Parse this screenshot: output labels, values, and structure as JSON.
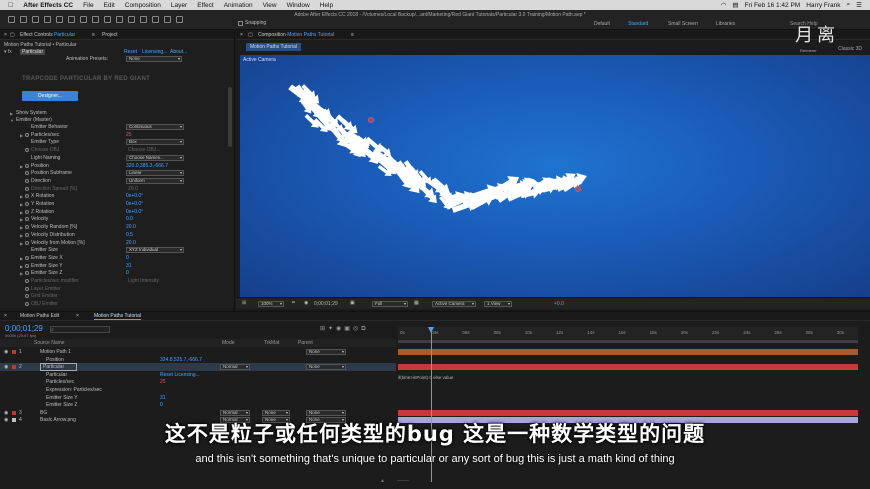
{
  "menubar": {
    "apple": "",
    "app": "After Effects CC",
    "items": [
      "File",
      "Edit",
      "Composition",
      "Layer",
      "Effect",
      "Animation",
      "View",
      "Window",
      "Help"
    ],
    "right": {
      "datetime": "Fri Feb 16  1:42 PM",
      "user": "Harry Frank"
    }
  },
  "window_title": "Adobe After Effects CC 2018 - /Volumes/Local Backup/...ant/Marketing/Red Giant Tutorials/Particular 3.0 Training/Motion Path.aep *",
  "toolbar": {
    "snapping": "Snapping"
  },
  "workspaces": {
    "default": "Default",
    "standard": "Standard",
    "small": "Small Screen",
    "libraries": "Libraries",
    "search": "Search Help",
    "classic": "Classic 3D"
  },
  "logo": {
    "glyph": "月离",
    "caption": "Renderer"
  },
  "effect_controls": {
    "tab": "Effect Controls",
    "tab_target": "Particular",
    "project_tab": "Project",
    "breadcrumb": "Motion Paths Tutorial • Particular",
    "fx_name": "Particular",
    "reset": "Reset",
    "licensing": "Licensing...",
    "about": "About...",
    "presets_label": "Animation Presets:",
    "presets_value": "None",
    "brand": "TRAPCODE PARTICULAR BY RED GIANT",
    "designer_btn": "Designer...",
    "show_system": "Show System",
    "emitter_group": "Emitter (Master)",
    "props": [
      {
        "name": "Emitter Behavior",
        "value": "Continuous",
        "kind": "select"
      },
      {
        "name": "Particles/sec",
        "value": "25",
        "kind": "red"
      },
      {
        "name": "Emitter Type",
        "value": "Box",
        "kind": "select"
      },
      {
        "name": "Choose OBJ",
        "value": "Choose OBJ...",
        "kind": "dim"
      },
      {
        "name": "Light Naming",
        "value": "Choose Names...",
        "kind": "button"
      },
      {
        "name": "Position",
        "value": "320.0,385.3,-666.7",
        "kind": "blue"
      },
      {
        "name": "Position Subframe",
        "value": "Linear",
        "kind": "select"
      },
      {
        "name": "Direction",
        "value": "Uniform",
        "kind": "select"
      },
      {
        "name": "Direction Spread [%]",
        "value": "20.0",
        "kind": "dim"
      },
      {
        "name": "X Rotation",
        "value": "0x+0.0°",
        "kind": "blue"
      },
      {
        "name": "Y Rotation",
        "value": "0x+0.0°",
        "kind": "blue"
      },
      {
        "name": "Z Rotation",
        "value": "0x+0.0°",
        "kind": "blue"
      },
      {
        "name": "Velocity",
        "value": "0.0",
        "kind": "blue"
      },
      {
        "name": "Velocity Random [%]",
        "value": "20.0",
        "kind": "blue"
      },
      {
        "name": "Velocity Distribution",
        "value": "0.5",
        "kind": "blue"
      },
      {
        "name": "Velocity from Motion [%]",
        "value": "20.0",
        "kind": "blue"
      },
      {
        "name": "Emitter Size",
        "value": "XYZ Individual",
        "kind": "select"
      },
      {
        "name": "Emitter Size X",
        "value": "0",
        "kind": "blue"
      },
      {
        "name": "Emitter Size Y",
        "value": "31",
        "kind": "blue"
      },
      {
        "name": "Emitter Size Z",
        "value": "0",
        "kind": "blue"
      },
      {
        "name": "Particles/sec modifier",
        "value": "Light Intensity",
        "kind": "dim"
      },
      {
        "name": "Layer Emitter",
        "value": "",
        "kind": "dim"
      },
      {
        "name": "Grid Emitter",
        "value": "",
        "kind": "dim"
      },
      {
        "name": "OBJ Emitter",
        "value": "",
        "kind": "dim"
      }
    ]
  },
  "composition": {
    "tab": "Composition",
    "tab_target": "Motion Paths Tutorial",
    "subtab": "Motion Paths Tutorial",
    "active_camera": "Active Camera",
    "viewer_bar": {
      "zoom": "100%",
      "time": "0;00;01;29",
      "resolution": "Full",
      "camera": "Active Camera",
      "view": "1 View",
      "exposure": "+0.0"
    }
  },
  "timeline": {
    "tabs": [
      "Motion Paths Edit",
      "Motion Paths Tutorial"
    ],
    "timecode": "0;00;01;29",
    "fps": "00059 (29.97 fps)",
    "columns": {
      "source": "Source Name",
      "mode": "Mode",
      "trkmat": "TrkMat",
      "parent": "Parent"
    },
    "ruler": [
      "0s",
      "04s",
      "06s",
      "08s",
      "10s",
      "12s",
      "14s",
      "16s",
      "18s",
      "20s",
      "22s",
      "24s",
      "26s",
      "28s",
      "30s"
    ],
    "layers": [
      {
        "num": "1",
        "name": "Motion Path 1",
        "color": "#c0392b",
        "parent": "None"
      },
      {
        "num": "",
        "name": "Position",
        "sub": true,
        "value": "324.8,525.7,-666.7"
      },
      {
        "num": "2",
        "name": "Particular",
        "color": "#c0392b",
        "mode": "Normal",
        "trk": "",
        "parent": "None",
        "selected": true
      },
      {
        "num": "",
        "name": "Particular",
        "sub": true,
        "value": "Reset   Licensing..."
      },
      {
        "num": "",
        "name": "Particles/sec",
        "sub": true,
        "value": "25"
      },
      {
        "num": "",
        "name": "Expression: Particles/sec",
        "sub": true,
        "value": ""
      },
      {
        "num": "",
        "name": "Emitter Size Y",
        "sub": true,
        "value": "31"
      },
      {
        "num": "",
        "name": "Emitter Size Z",
        "sub": true,
        "value": "0"
      },
      {
        "num": "3",
        "name": "BG",
        "color": "#c0392b",
        "mode": "Normal",
        "trk": "None",
        "parent": "None"
      },
      {
        "num": "4",
        "name": "Basic Arrow.png",
        "color": "#c0c0c0",
        "mode": "Normal",
        "trk": "None",
        "parent": "None"
      }
    ],
    "expression_text": "if(time>inPoint) 0 else value"
  },
  "subtitles": {
    "cn": "这不是粒子或任何类型的bug  这是一种数学类型的问题",
    "en": "and this isn't something that's unique to particular or any sort of bug this is just a math kind of thing"
  },
  "colors": {
    "accent": "#4aa3ff",
    "viewer": "#1a5bb7",
    "layer_red": "#c73a3a",
    "layer_orange": "#a85a2a",
    "layer_lav": "#a6a6d8"
  }
}
